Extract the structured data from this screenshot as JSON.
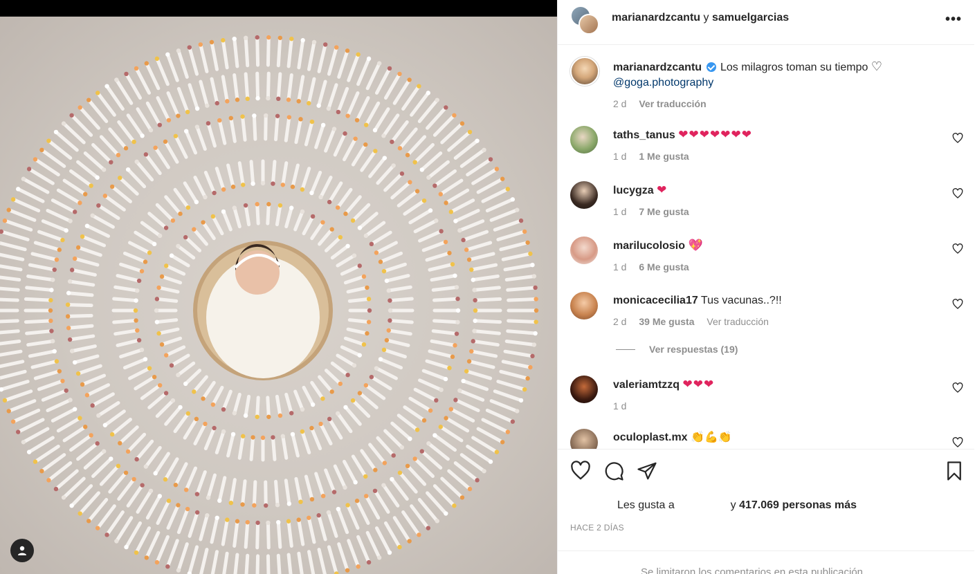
{
  "header": {
    "user1": "marianardzcantu",
    "connector": "y",
    "user2": "samuelgarcias",
    "more_label": "•••"
  },
  "caption": {
    "username": "marianardzcantu",
    "text": "Los milagros toman su tiempo",
    "heart": "♡",
    "mention": "@goga.photography",
    "time": "2 d",
    "translate": "Ver traducción"
  },
  "comments": [
    {
      "username": "taths_tanus",
      "text": "",
      "emoji": "❤❤❤❤❤❤❤",
      "time": "1 d",
      "likes": "1 Me gusta",
      "extra": ""
    },
    {
      "username": "lucygza",
      "text": "",
      "emoji": "❤",
      "time": "1 d",
      "likes": "7 Me gusta",
      "extra": ""
    },
    {
      "username": "marilucolosio",
      "text": "",
      "emoji": "💖",
      "time": "1 d",
      "likes": "6 Me gusta",
      "extra": ""
    },
    {
      "username": "monicacecilia17",
      "text": "Tus vacunas..?!!",
      "emoji": "",
      "time": "2 d",
      "likes": "39 Me gusta",
      "extra": "Ver traducción"
    },
    {
      "username": "valeriamtzzq",
      "text": "",
      "emoji": "❤❤❤",
      "time": "1 d",
      "likes": "",
      "extra": ""
    },
    {
      "username": "oculoplast.mx",
      "text": "",
      "emoji": "👏💪👏",
      "time": "",
      "likes": "",
      "extra": ""
    }
  ],
  "replies_label": "Ver respuestas (19)",
  "likes": {
    "prefix": "Les gusta a",
    "middle": "y",
    "count": "417.069 personas más"
  },
  "time_ago": "HACE 2 DÍAS",
  "limited_text": "Se limitaron los comentarios en esta publicación",
  "colors": {
    "text": "#262626",
    "secondary": "#8e8e8e",
    "link": "#00376b",
    "verified": "#3897f0",
    "heart": "#e0245e"
  }
}
